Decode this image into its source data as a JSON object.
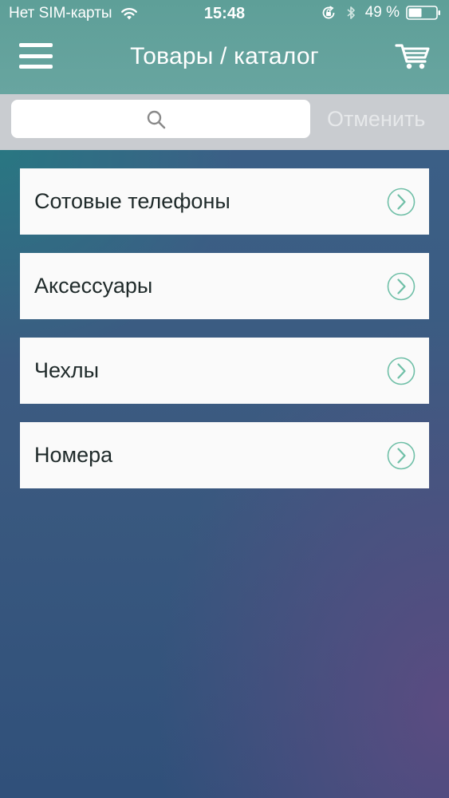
{
  "status_bar": {
    "carrier": "Нет SIM-карты",
    "time": "15:48",
    "battery": "49 %"
  },
  "nav": {
    "title": "Товары / каталог",
    "menu_icon": "hamburger-menu-icon",
    "cart_icon": "cart-icon"
  },
  "search": {
    "placeholder": "",
    "value": "",
    "cancel_label": "Отменить"
  },
  "catalog": {
    "items": [
      {
        "label": "Сотовые телефоны"
      },
      {
        "label": "Аксессуары"
      },
      {
        "label": "Чехлы"
      },
      {
        "label": "Номера"
      }
    ]
  },
  "colors": {
    "header": "#66a39e",
    "search_bar_bg": "#c9ccd0",
    "chevron": "#6fbfa7",
    "item_bg": "#fafafa"
  }
}
